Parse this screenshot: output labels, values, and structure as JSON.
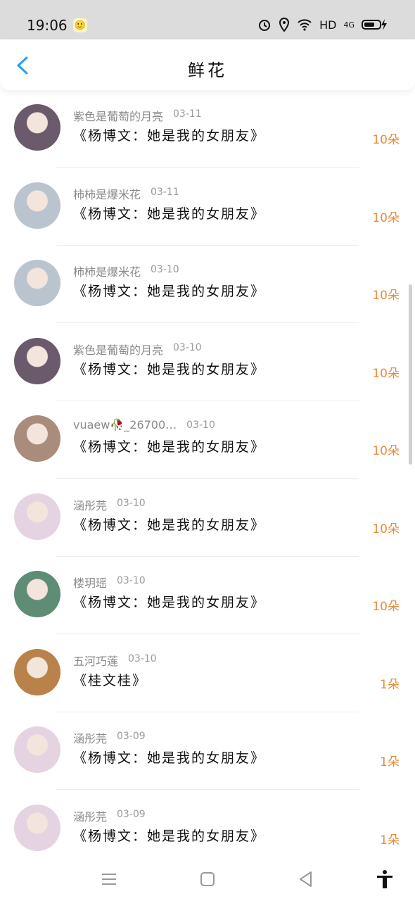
{
  "status": {
    "time": "19:06",
    "app_icon": "wechat-mini-icon",
    "right_icons": [
      "alarm-icon",
      "location-icon",
      "wifi-icon",
      "hd-icon",
      "4g-signal-icon",
      "battery-charging-icon"
    ],
    "hd_label": "HD",
    "net_label": "4G"
  },
  "header": {
    "title": "鲜花",
    "back_icon": "back-arrow-icon"
  },
  "rows": [
    {
      "name": "紫色是葡萄的月亮",
      "date": "03-11",
      "title": "《杨博文：她是我的女朋友》",
      "amount": "10朵",
      "avatar_color": "#6b5a6b"
    },
    {
      "name": "柿柿是爆米花",
      "date": "03-11",
      "title": "《杨博文：她是我的女朋友》",
      "amount": "10朵",
      "avatar_color": "#b9c4cf"
    },
    {
      "name": "柿柿是爆米花",
      "date": "03-10",
      "title": "《杨博文：她是我的女朋友》",
      "amount": "10朵",
      "avatar_color": "#b9c4cf"
    },
    {
      "name": "紫色是葡萄的月亮",
      "date": "03-10",
      "title": "《杨博文：她是我的女朋友》",
      "amount": "10朵",
      "avatar_color": "#6b5a6b"
    },
    {
      "name": "vuaew🥀_26700…",
      "date": "03-10",
      "title": "《杨博文：她是我的女朋友》",
      "amount": "10朵",
      "avatar_color": "#a98c7b"
    },
    {
      "name": "涵彤芫",
      "date": "03-10",
      "title": "《杨博文：她是我的女朋友》",
      "amount": "10朵",
      "avatar_color": "#e6d3e2"
    },
    {
      "name": "楼玥瑶",
      "date": "03-10",
      "title": "《杨博文：她是我的女朋友》",
      "amount": "10朵",
      "avatar_color": "#5e8c74"
    },
    {
      "name": "五河巧莲",
      "date": "03-10",
      "title": "《桂文桂》",
      "amount": "1朵",
      "avatar_color": "#b8824a"
    },
    {
      "name": "涵彤芫",
      "date": "03-09",
      "title": "《杨博文：她是我的女朋友》",
      "amount": "1朵",
      "avatar_color": "#e6d3e2"
    },
    {
      "name": "涵彤芫",
      "date": "03-09",
      "title": "《杨博文：她是我的女朋友》",
      "amount": "1朵",
      "avatar_color": "#e6d3e2"
    }
  ],
  "nav": [
    "menu-icon",
    "home-square-icon",
    "back-triangle-icon",
    "accessibility-icon"
  ],
  "colors": {
    "amount": "#ea8c3c",
    "back_arrow": "#2a9df4",
    "name": "#8a8a8a"
  }
}
